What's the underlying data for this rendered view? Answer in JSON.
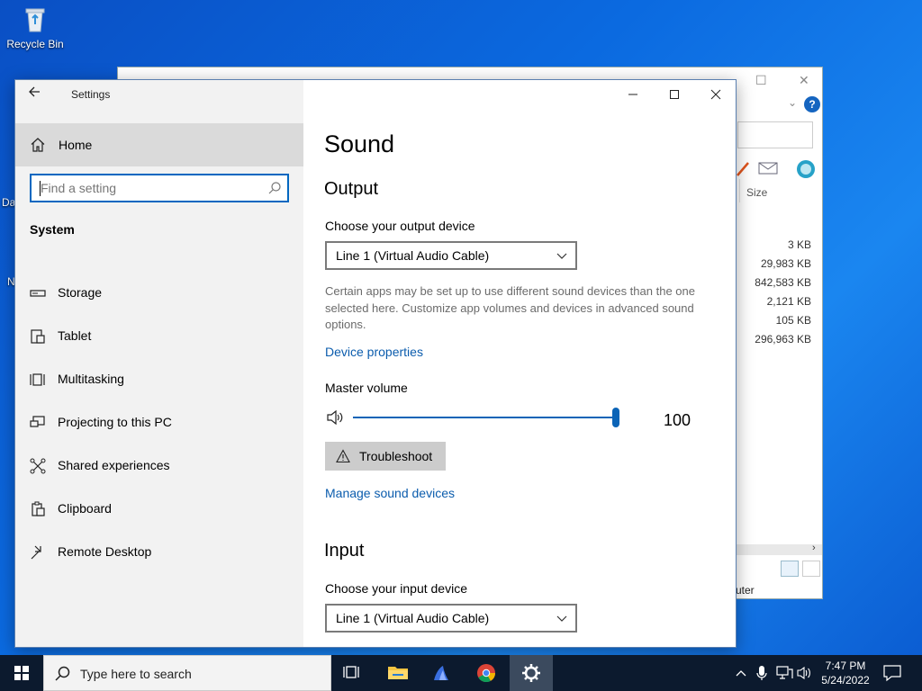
{
  "desktop": {
    "recycle_bin_label": "Recycle Bin",
    "fragment_1": "Da",
    "fragment_2": "N"
  },
  "explorer": {
    "col_size": "Size",
    "sizes": [
      "3 KB",
      "29,983 KB",
      "842,583 KB",
      "2,121 KB",
      "105 KB",
      "296,963 KB"
    ],
    "status_fragment": "uter"
  },
  "settings": {
    "app_title": "Settings",
    "home_label": "Home",
    "search_placeholder": "Find a setting",
    "section_label": "System",
    "nav_items": [
      {
        "label": "Storage",
        "icon": "storage-icon"
      },
      {
        "label": "Tablet",
        "icon": "tablet-icon"
      },
      {
        "label": "Multitasking",
        "icon": "multitasking-icon"
      },
      {
        "label": "Projecting to this PC",
        "icon": "projecting-icon"
      },
      {
        "label": "Shared experiences",
        "icon": "shared-experiences-icon"
      },
      {
        "label": "Clipboard",
        "icon": "clipboard-icon"
      },
      {
        "label": "Remote Desktop",
        "icon": "remote-desktop-icon"
      }
    ],
    "page_title": "Sound",
    "output": {
      "heading": "Output",
      "device_label": "Choose your output device",
      "device_value": "Line 1 (Virtual Audio Cable)",
      "description": "Certain apps may be set up to use different sound devices than the one selected here. Customize app volumes and devices in advanced sound options.",
      "device_properties_link": "Device properties",
      "master_volume_label": "Master volume",
      "volume": 100,
      "volume_text": "100",
      "troubleshoot_label": "Troubleshoot",
      "manage_link": "Manage sound devices"
    },
    "input": {
      "heading": "Input",
      "device_label": "Choose your input device",
      "device_value": "Line 1 (Virtual Audio Cable)"
    }
  },
  "taskbar": {
    "search_placeholder": "Type here to search",
    "apps": [
      "task-view-icon",
      "file-explorer-icon",
      "app-icon",
      "chrome-icon",
      "settings-icon"
    ],
    "time": "7:47 PM",
    "date": "5/24/2022"
  },
  "colors": {
    "accent": "#0067c0",
    "link": "#0b5cad",
    "sidebar_bg": "#f2f2f2",
    "taskbar_bg": "#0c1a2e"
  }
}
